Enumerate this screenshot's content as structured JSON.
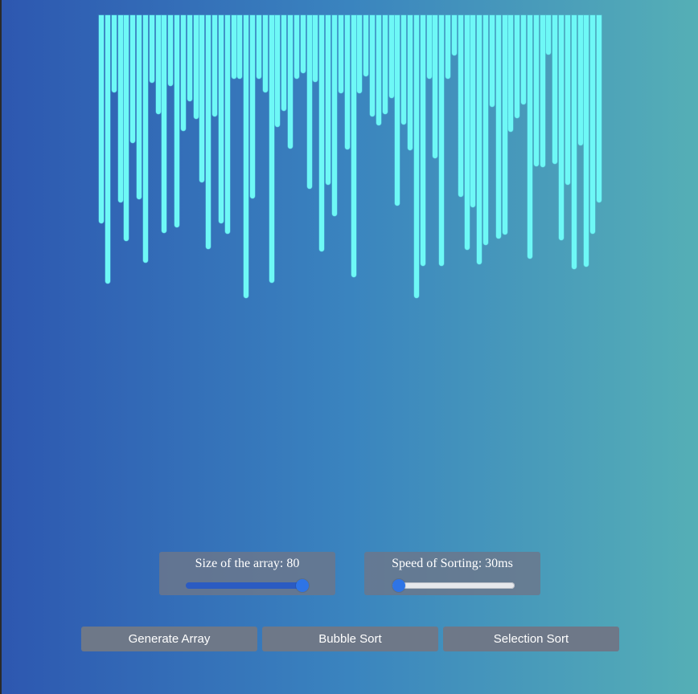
{
  "array_bars": {
    "count": 80,
    "values": [
      259,
      334,
      96,
      233,
      281,
      159,
      229,
      308,
      84,
      123,
      271,
      88,
      264,
      144,
      107,
      129,
      208,
      291,
      126,
      259,
      272,
      79,
      79,
      352,
      228,
      79,
      96,
      333,
      139,
      119,
      166,
      79,
      72,
      216,
      83,
      294,
      211,
      250,
      97,
      167,
      326,
      97,
      76,
      126,
      137,
      123,
      103,
      237,
      136,
      168,
      352,
      312,
      79,
      178,
      312,
      79,
      50,
      226,
      292,
      239,
      310,
      286,
      114,
      278,
      273,
      145,
      128,
      111,
      303,
      188,
      189,
      49,
      185,
      280,
      211,
      316,
      162,
      313,
      272,
      233
    ],
    "max_value": 360,
    "color": "#6ef8f6"
  },
  "controls": {
    "size": {
      "label": "Size of the array:",
      "value": "80",
      "level": 1.0
    },
    "speed": {
      "label": "Speed of Sorting:",
      "value": "30ms",
      "level": 0.0
    }
  },
  "buttons": {
    "generate_label": "Generate Array",
    "bubble_label": "Bubble Sort",
    "selection_label": "Selection Sort"
  },
  "colors": {
    "background_start": "#2d57b0",
    "background_end": "#55afb6",
    "panel": "#6c768a",
    "button": "#6e7888",
    "slider_accent": "#2e74e6"
  }
}
